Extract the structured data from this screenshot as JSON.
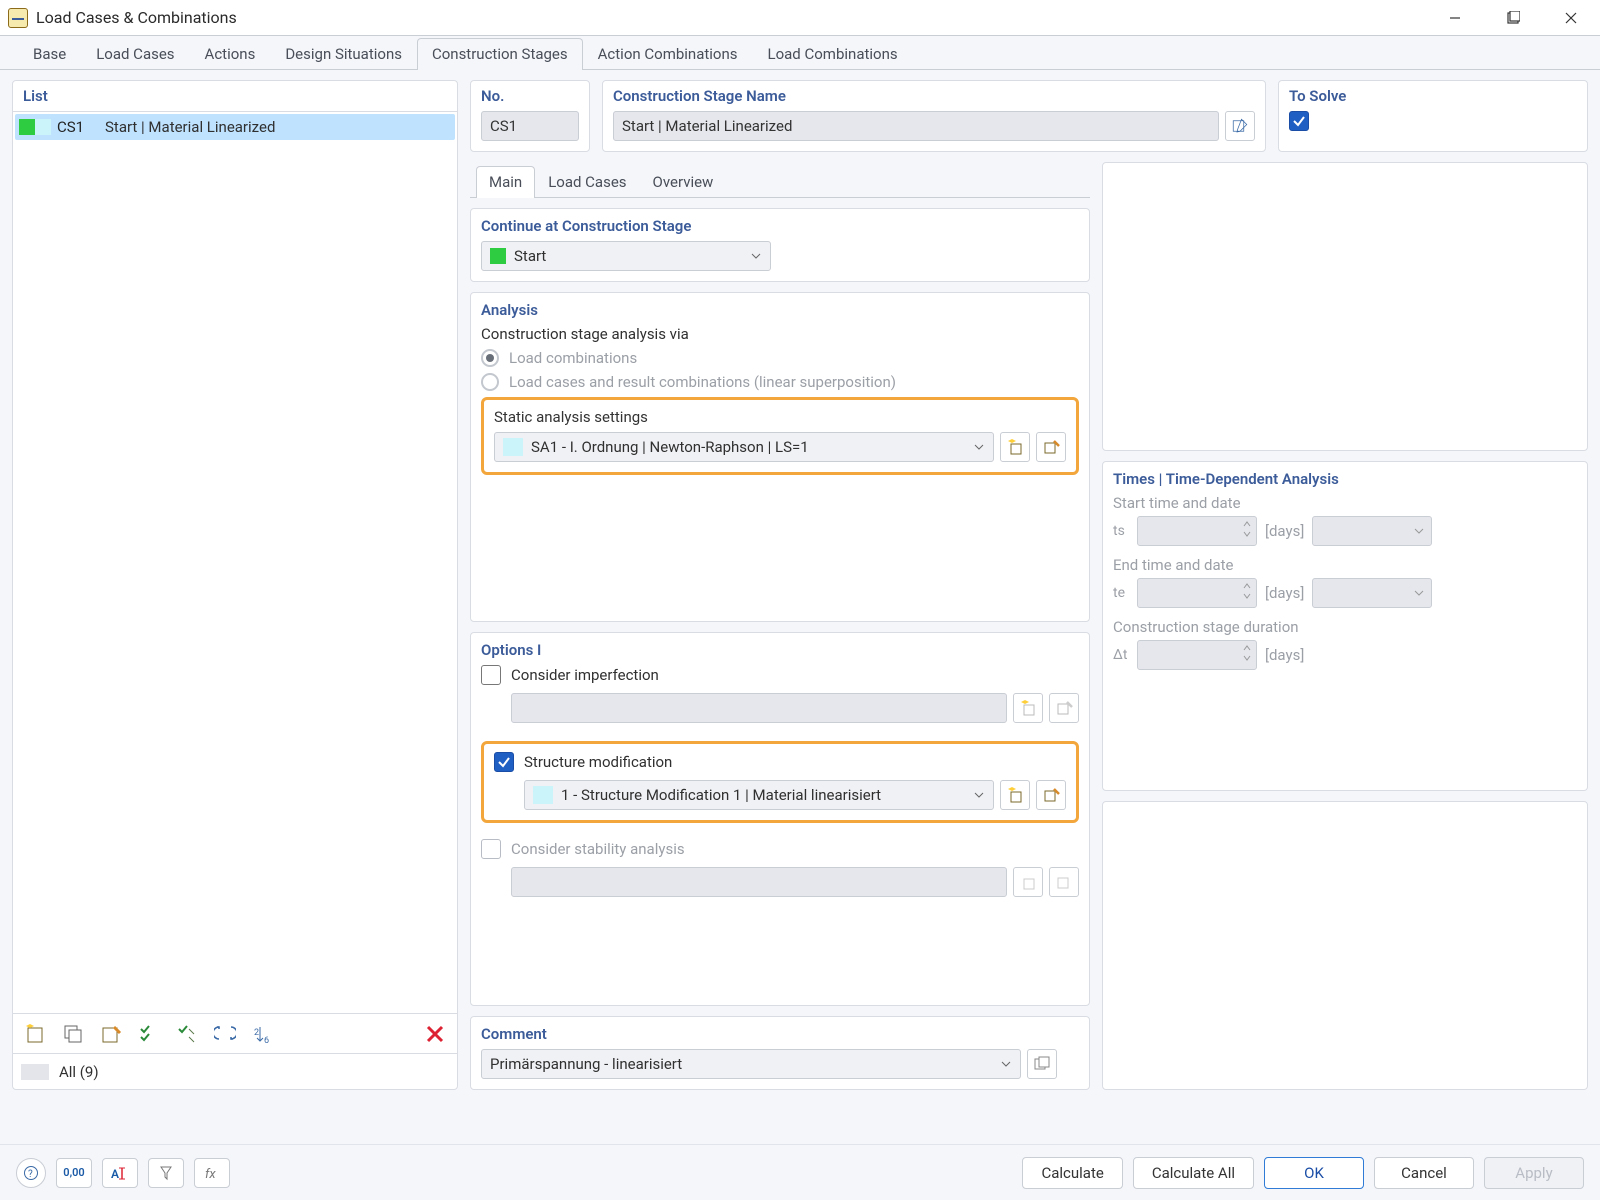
{
  "window": {
    "title": "Load Cases & Combinations"
  },
  "topTabs": {
    "base": "Base",
    "loadCases": "Load Cases",
    "actions": "Actions",
    "designSituations": "Design Situations",
    "constructionStages": "Construction Stages",
    "actionCombinations": "Action Combinations",
    "loadCombinations": "Load Combinations"
  },
  "list": {
    "header": "List",
    "items": [
      {
        "code": "CS1",
        "name": "Start | Material Linearized"
      }
    ],
    "filter": "All (9)"
  },
  "header": {
    "noLabel": "No.",
    "noValue": "CS1",
    "nameLabel": "Construction Stage Name",
    "nameValue": "Start | Material Linearized",
    "toSolveLabel": "To Solve"
  },
  "subTabs": {
    "main": "Main",
    "loadCases": "Load Cases",
    "overview": "Overview"
  },
  "continue": {
    "title": "Continue at Construction Stage",
    "value": "Start"
  },
  "analysis": {
    "title": "Analysis",
    "via": "Construction stage analysis via",
    "opt1": "Load combinations",
    "opt2": "Load cases and result combinations (linear superposition)",
    "staticLabel": "Static analysis settings",
    "staticValue": "SA1 - I. Ordnung | Newton-Raphson | LS=1"
  },
  "times": {
    "title": "Times | Time-Dependent Analysis",
    "startLabel": "Start time and date",
    "ts": "ts",
    "endLabel": "End time and date",
    "te": "te",
    "durationLabel": "Construction stage duration",
    "dt": "Δt",
    "days": "[days]"
  },
  "options": {
    "title": "Options I",
    "imperfection": "Consider imperfection",
    "structMod": "Structure modification",
    "structModValue": "1 - Structure Modification 1 | Material linearisiert",
    "stability": "Consider stability analysis"
  },
  "comment": {
    "title": "Comment",
    "value": "Primärspannung - linearisiert"
  },
  "footer": {
    "calculate": "Calculate",
    "calculateAll": "Calculate All",
    "ok": "OK",
    "cancel": "Cancel",
    "apply": "Apply"
  }
}
